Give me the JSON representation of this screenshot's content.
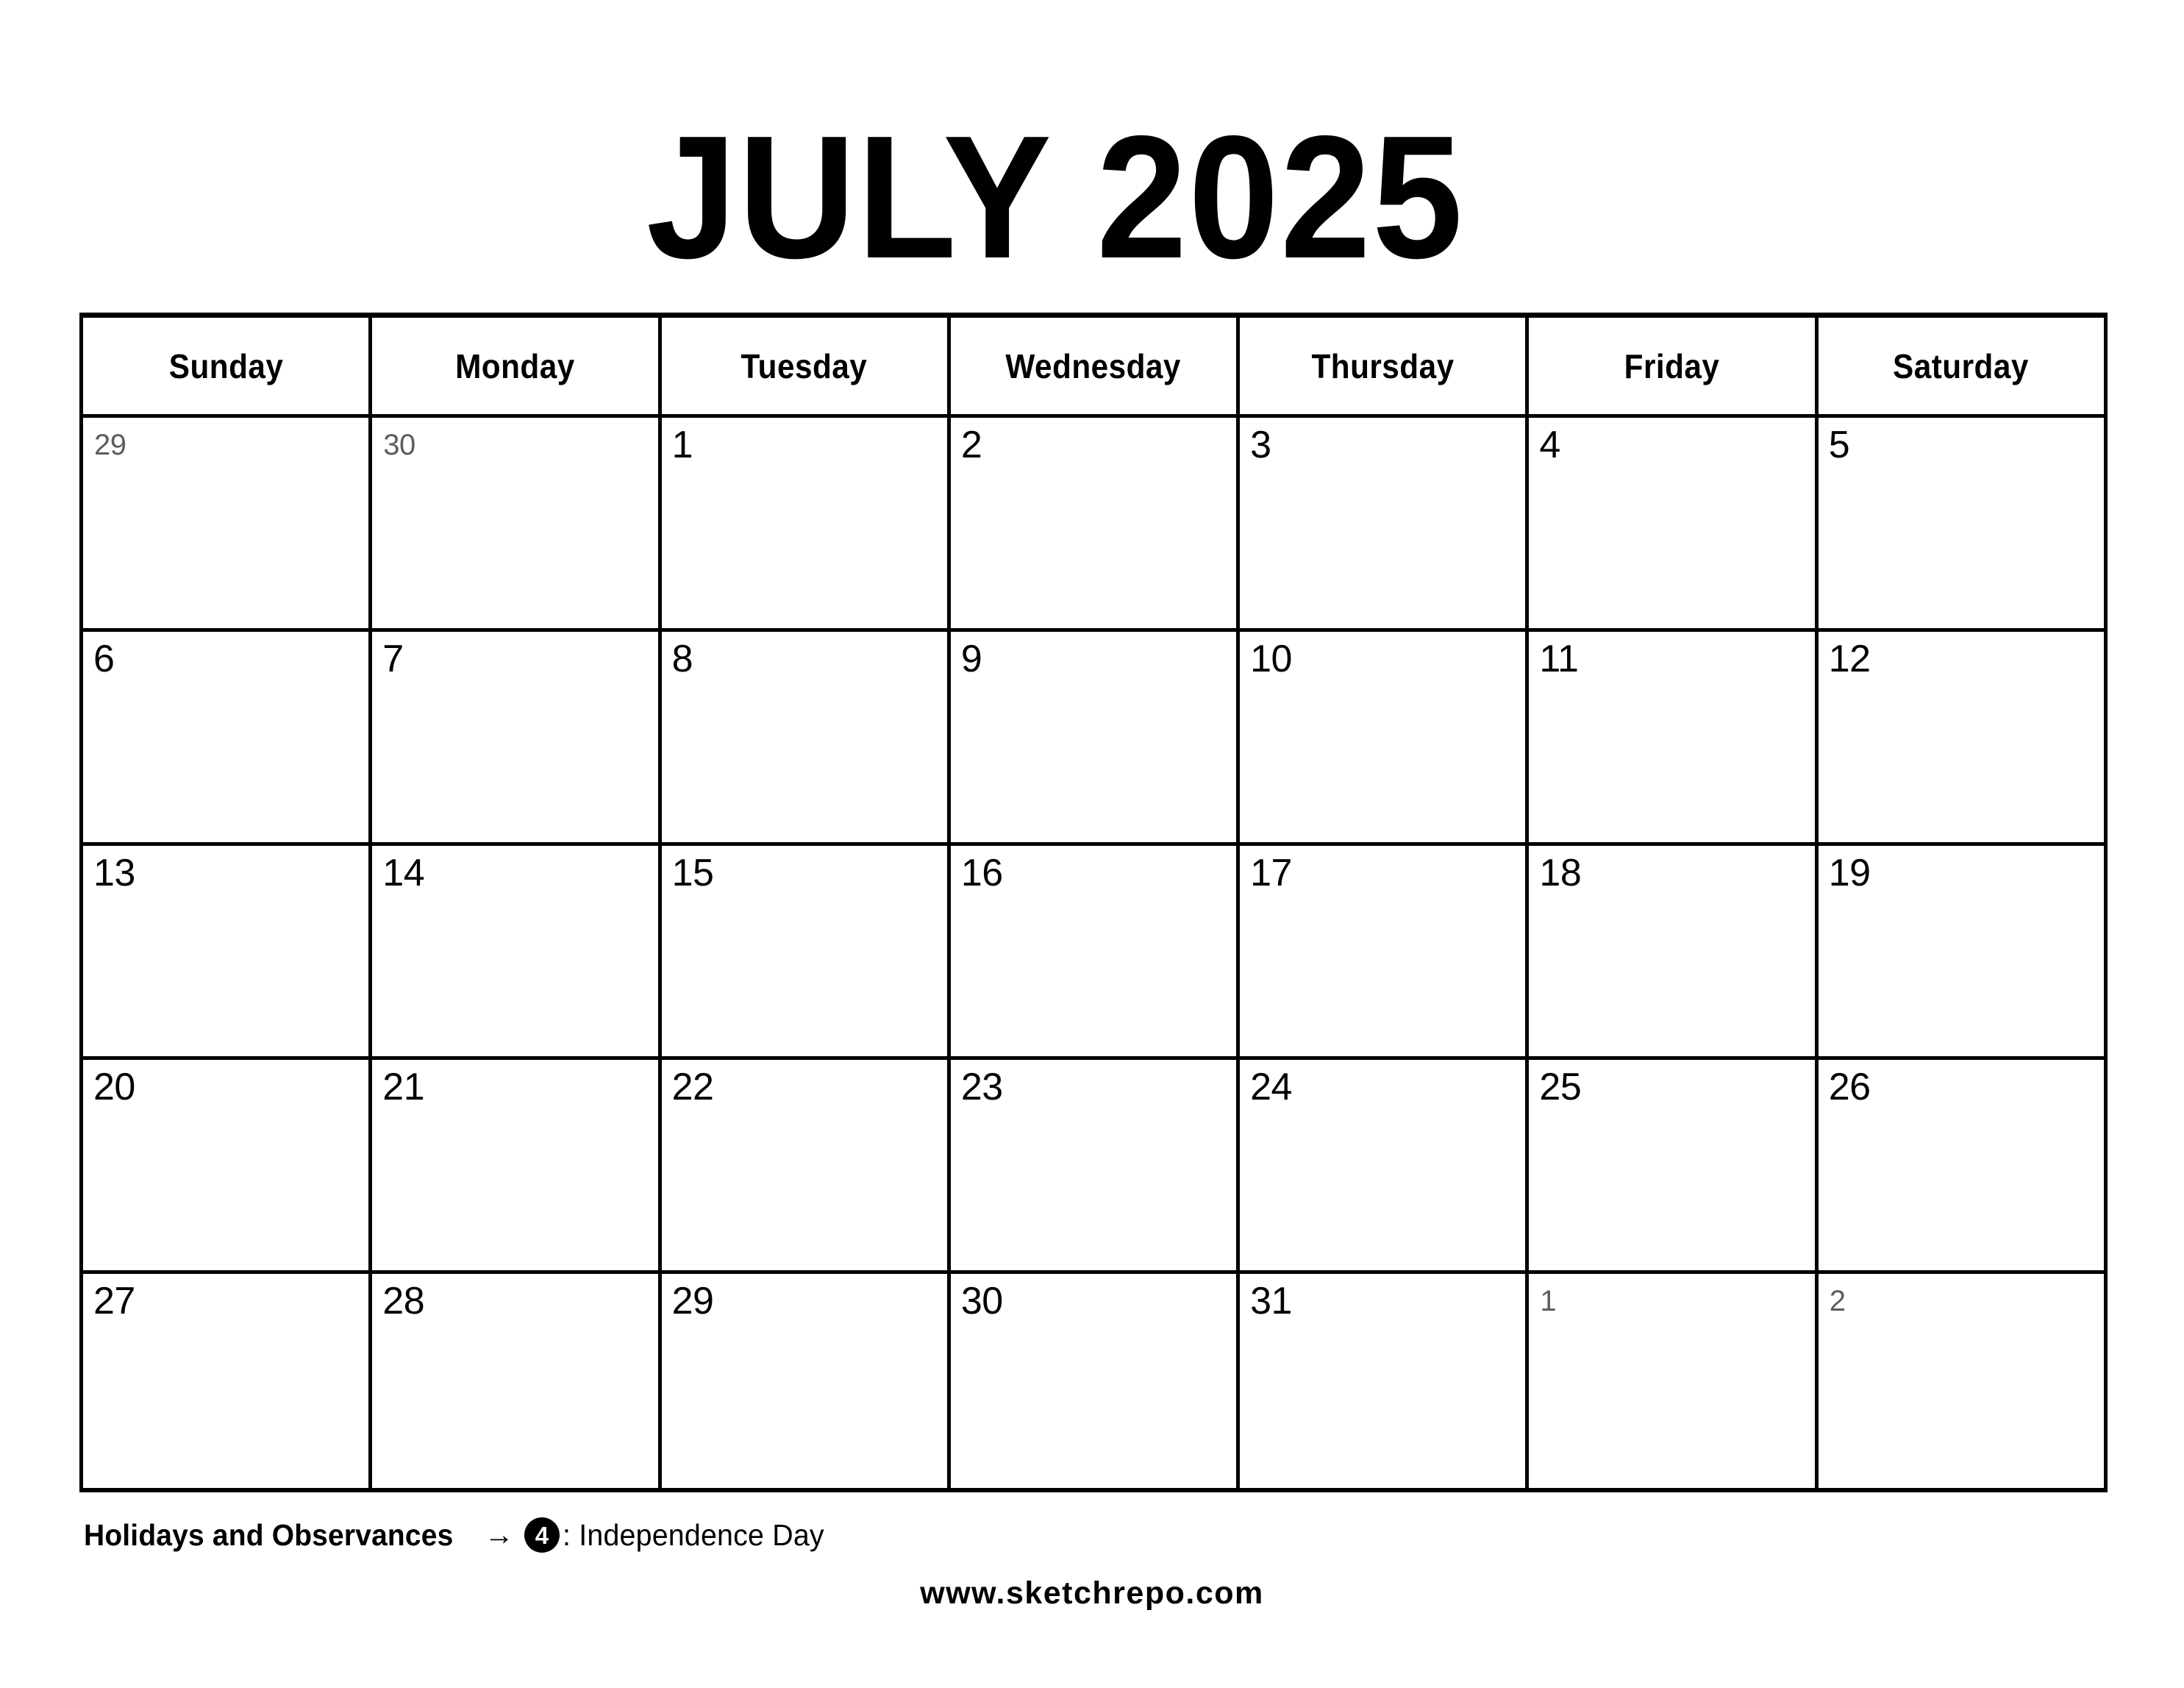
{
  "title": "JULY 2025",
  "month": "July",
  "year": "2025",
  "weekday_headers": [
    "Sunday",
    "Monday",
    "Tuesday",
    "Wednesday",
    "Thursday",
    "Friday",
    "Saturday"
  ],
  "weeks": [
    [
      {
        "num": "29",
        "out": true
      },
      {
        "num": "30",
        "out": true
      },
      {
        "num": "1",
        "out": false
      },
      {
        "num": "2",
        "out": false
      },
      {
        "num": "3",
        "out": false
      },
      {
        "num": "4",
        "out": false
      },
      {
        "num": "5",
        "out": false
      }
    ],
    [
      {
        "num": "6",
        "out": false
      },
      {
        "num": "7",
        "out": false
      },
      {
        "num": "8",
        "out": false
      },
      {
        "num": "9",
        "out": false
      },
      {
        "num": "10",
        "out": false
      },
      {
        "num": "11",
        "out": false
      },
      {
        "num": "12",
        "out": false
      }
    ],
    [
      {
        "num": "13",
        "out": false
      },
      {
        "num": "14",
        "out": false
      },
      {
        "num": "15",
        "out": false
      },
      {
        "num": "16",
        "out": false
      },
      {
        "num": "17",
        "out": false
      },
      {
        "num": "18",
        "out": false
      },
      {
        "num": "19",
        "out": false
      }
    ],
    [
      {
        "num": "20",
        "out": false
      },
      {
        "num": "21",
        "out": false
      },
      {
        "num": "22",
        "out": false
      },
      {
        "num": "23",
        "out": false
      },
      {
        "num": "24",
        "out": false
      },
      {
        "num": "25",
        "out": false
      },
      {
        "num": "26",
        "out": false
      }
    ],
    [
      {
        "num": "27",
        "out": false
      },
      {
        "num": "28",
        "out": false
      },
      {
        "num": "29",
        "out": false
      },
      {
        "num": "30",
        "out": false
      },
      {
        "num": "31",
        "out": false
      },
      {
        "num": "1",
        "out": true
      },
      {
        "num": "2",
        "out": true
      }
    ]
  ],
  "footer": {
    "holidays_label": "Holidays and Observances",
    "arrow": "→",
    "holiday_badge_number": "4",
    "holiday_description": ": Independence Day",
    "site_url": "www.sketchrepo.com"
  },
  "colors": {
    "text": "#000000",
    "out_of_month_text": "#5d5d5d",
    "border": "#000000",
    "background": "#ffffff",
    "badge_background": "#000000",
    "badge_text": "#ffffff"
  }
}
